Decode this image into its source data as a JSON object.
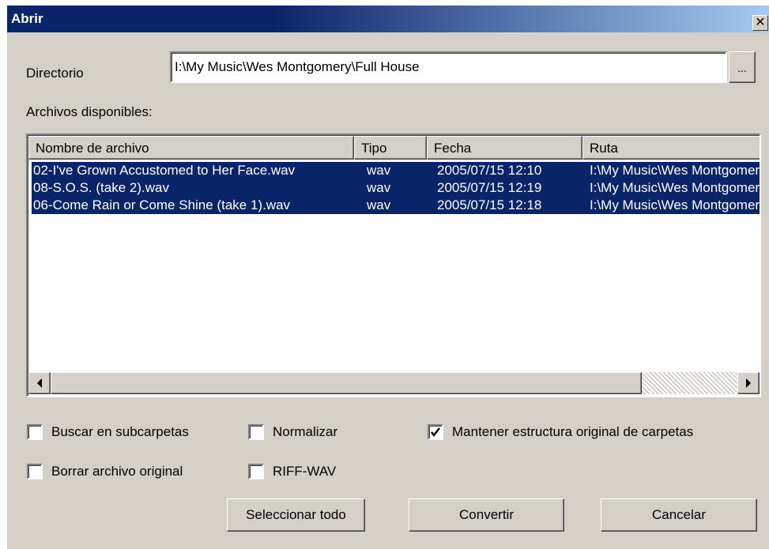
{
  "window": {
    "title": "Abrir",
    "close_glyph": "✕"
  },
  "directory": {
    "label": "Directorio",
    "value": "I:\\My Music\\Wes Montgomery\\Full House",
    "browse_label": "..."
  },
  "files_label": "Archivos disponibles:",
  "table": {
    "columns": [
      "Nombre de archivo",
      "Tipo",
      "Fecha",
      "Ruta"
    ],
    "rows": [
      [
        "02-I've Grown Accustomed to Her Face.wav",
        "wav",
        "2005/07/15 12:10",
        "I:\\My Music\\Wes Montgomery\\Full House"
      ],
      [
        "08-S.O.S. (take 2).wav",
        "wav",
        "2005/07/15 12:19",
        "I:\\My Music\\Wes Montgomery\\Full House"
      ],
      [
        "06-Come Rain or Come Shine (take 1).wav",
        "wav",
        "2005/07/15 12:18",
        "I:\\My Music\\Wes Montgomery\\Full House"
      ]
    ]
  },
  "options": {
    "search_subfolders": {
      "label": "Buscar en subcarpetas",
      "checked": false
    },
    "normalize": {
      "label": "Normalizar",
      "checked": false
    },
    "keep_structure": {
      "label": "Mantener estructura original de carpetas",
      "checked": true
    },
    "delete_original": {
      "label": "Borrar archivo original",
      "checked": false
    },
    "riff_wav": {
      "label": "RIFF-WAV",
      "checked": false
    }
  },
  "buttons": {
    "select_all": "Seleccionar todo",
    "convert": "Convertir",
    "cancel": "Cancelar"
  },
  "icons": {
    "close": "close-icon",
    "scroll_left": "arrow-left-icon",
    "scroll_right": "arrow-right-icon",
    "checkmark": "checkmark-icon"
  },
  "colors": {
    "selection": "#0a246a",
    "face": "#d4d0c8"
  }
}
